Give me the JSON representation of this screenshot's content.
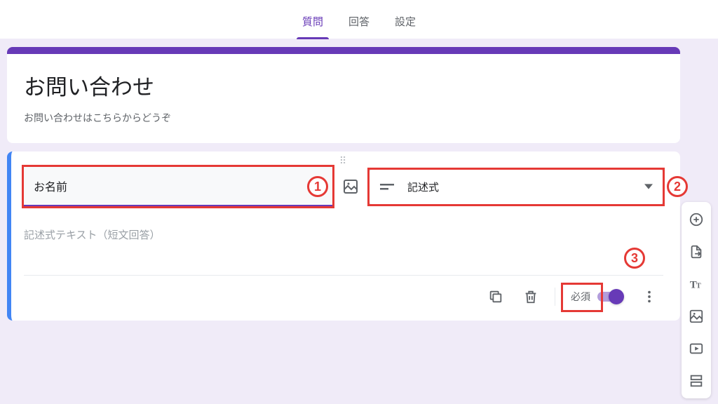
{
  "tabs": {
    "questions": "質問",
    "responses": "回答",
    "settings": "設定"
  },
  "header": {
    "title": "お問い合わせ",
    "description": "お問い合わせはこちらからどうぞ"
  },
  "question": {
    "title": "お名前",
    "type_label": "記述式",
    "answer_placeholder": "記述式テキスト（短文回答）",
    "required_label": "必須"
  },
  "annotations": {
    "one": "1",
    "two": "2",
    "three": "3"
  }
}
